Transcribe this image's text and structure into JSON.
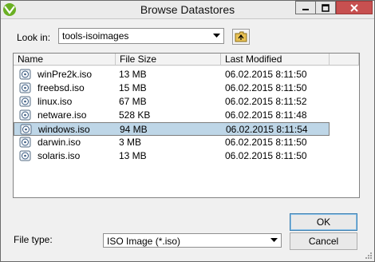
{
  "window": {
    "title": "Browse Datastores",
    "controls": {
      "minimize": "–",
      "maximize": "☐",
      "close": "✕"
    }
  },
  "look_in": {
    "label": "Look in:",
    "value": "tools-isoimages"
  },
  "file_list": {
    "columns": {
      "name": "Name",
      "size": "File Size",
      "modified": "Last Modified"
    },
    "rows": [
      {
        "name": "winPre2k.iso",
        "size": "13 MB",
        "modified": "06.02.2015 8:11:50"
      },
      {
        "name": "freebsd.iso",
        "size": "15 MB",
        "modified": "06.02.2015 8:11:50"
      },
      {
        "name": "linux.iso",
        "size": "67 MB",
        "modified": "06.02.2015 8:11:52"
      },
      {
        "name": "netware.iso",
        "size": "528 KB",
        "modified": "06.02.2015 8:11:48"
      },
      {
        "name": "windows.iso",
        "size": "94 MB",
        "modified": "06.02.2015 8:11:54"
      },
      {
        "name": "darwin.iso",
        "size": "3 MB",
        "modified": "06.02.2015 8:11:50"
      },
      {
        "name": "solaris.iso",
        "size": "13 MB",
        "modified": "06.02.2015 8:11:50"
      }
    ],
    "selected_row": "windows.iso"
  },
  "file_type": {
    "label": "File type:",
    "value": "ISO Image (*.iso)"
  },
  "buttons": {
    "ok": "OK",
    "cancel": "Cancel"
  },
  "colors": {
    "selection": "#bed6e7",
    "close_button": "#c75050",
    "app_icon": "#6ab023"
  }
}
